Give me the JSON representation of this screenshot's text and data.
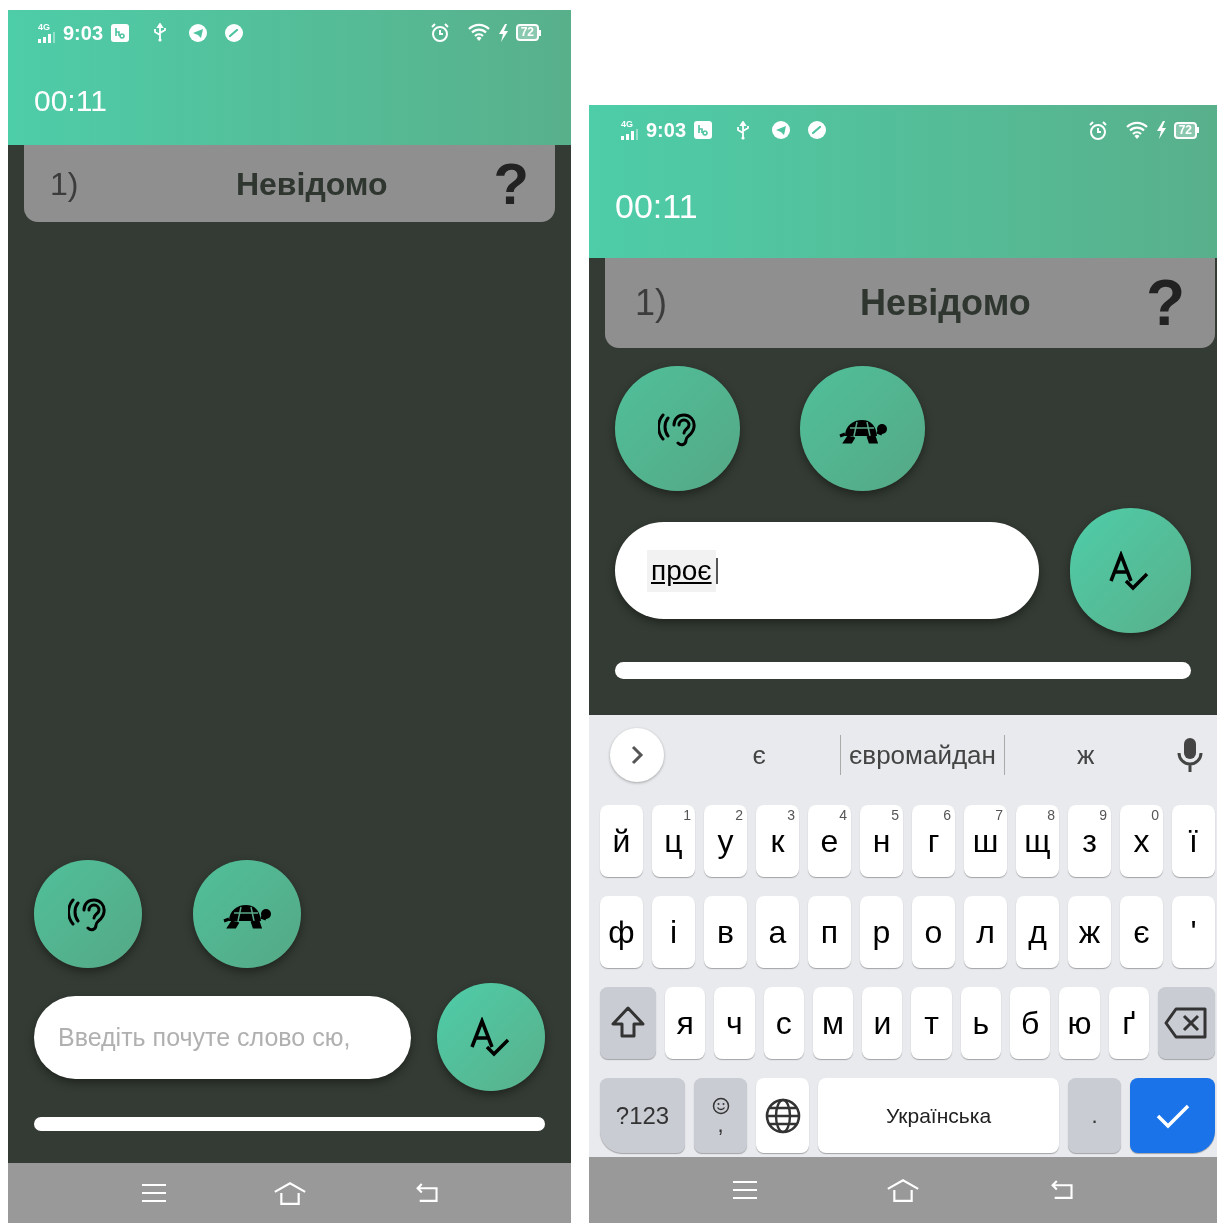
{
  "screens": [
    {
      "status_bar": {
        "network": "4G",
        "time": "9:03",
        "battery": "72"
      },
      "timer": "00:11",
      "word_card": {
        "number": "1)",
        "word": "Невідомо",
        "mark": "?"
      },
      "input": {
        "placeholder": "Введіть почуте слово сю,"
      }
    },
    {
      "status_bar": {
        "network": "4G",
        "time": "9:03",
        "battery": "72"
      },
      "timer": "00:11",
      "word_card": {
        "number": "1)",
        "word": "Невідомо",
        "mark": "?"
      },
      "input": {
        "value": "проє"
      },
      "keyboard": {
        "suggestions": [
          "є",
          "євромайдан",
          "ж"
        ],
        "rows": [
          {
            "keys": [
              {
                "kind": "letter",
                "label": "й"
              },
              {
                "kind": "letter",
                "label": "ц",
                "hint": "1"
              },
              {
                "kind": "letter",
                "label": "у",
                "hint": "2"
              },
              {
                "kind": "letter",
                "label": "к",
                "hint": "3"
              },
              {
                "kind": "letter",
                "label": "е",
                "hint": "4"
              },
              {
                "kind": "letter",
                "label": "н",
                "hint": "5"
              },
              {
                "kind": "letter",
                "label": "г",
                "hint": "6"
              },
              {
                "kind": "letter",
                "label": "ш",
                "hint": "7"
              },
              {
                "kind": "letter",
                "label": "щ",
                "hint": "8"
              },
              {
                "kind": "letter",
                "label": "з",
                "hint": "9"
              },
              {
                "kind": "letter",
                "label": "х",
                "hint": "0"
              },
              {
                "kind": "letter",
                "label": "ї"
              }
            ]
          },
          {
            "keys": [
              {
                "kind": "letter",
                "label": "ф"
              },
              {
                "kind": "letter",
                "label": "і"
              },
              {
                "kind": "letter",
                "label": "в"
              },
              {
                "kind": "letter",
                "label": "а"
              },
              {
                "kind": "letter",
                "label": "п"
              },
              {
                "kind": "letter",
                "label": "р"
              },
              {
                "kind": "letter",
                "label": "о"
              },
              {
                "kind": "letter",
                "label": "л"
              },
              {
                "kind": "letter",
                "label": "д"
              },
              {
                "kind": "letter",
                "label": "ж"
              },
              {
                "kind": "letter",
                "label": "є"
              },
              {
                "kind": "letter",
                "label": "'"
              }
            ]
          },
          {
            "keys": [
              {
                "kind": "shift"
              },
              {
                "kind": "letter",
                "label": "я"
              },
              {
                "kind": "letter",
                "label": "ч"
              },
              {
                "kind": "letter",
                "label": "с"
              },
              {
                "kind": "letter",
                "label": "м"
              },
              {
                "kind": "letter",
                "label": "и"
              },
              {
                "kind": "letter",
                "label": "т"
              },
              {
                "kind": "letter",
                "label": "ь"
              },
              {
                "kind": "letter",
                "label": "б"
              },
              {
                "kind": "letter",
                "label": "ю"
              },
              {
                "kind": "letter",
                "label": "ґ"
              },
              {
                "kind": "backspace"
              }
            ]
          },
          {
            "keys": [
              {
                "kind": "symbols",
                "label": "?123"
              },
              {
                "kind": "emoji",
                "label": ","
              },
              {
                "kind": "language"
              },
              {
                "kind": "space",
                "label": "Українська"
              },
              {
                "kind": "period",
                "label": "."
              },
              {
                "kind": "enter"
              }
            ]
          }
        ]
      }
    }
  ]
}
